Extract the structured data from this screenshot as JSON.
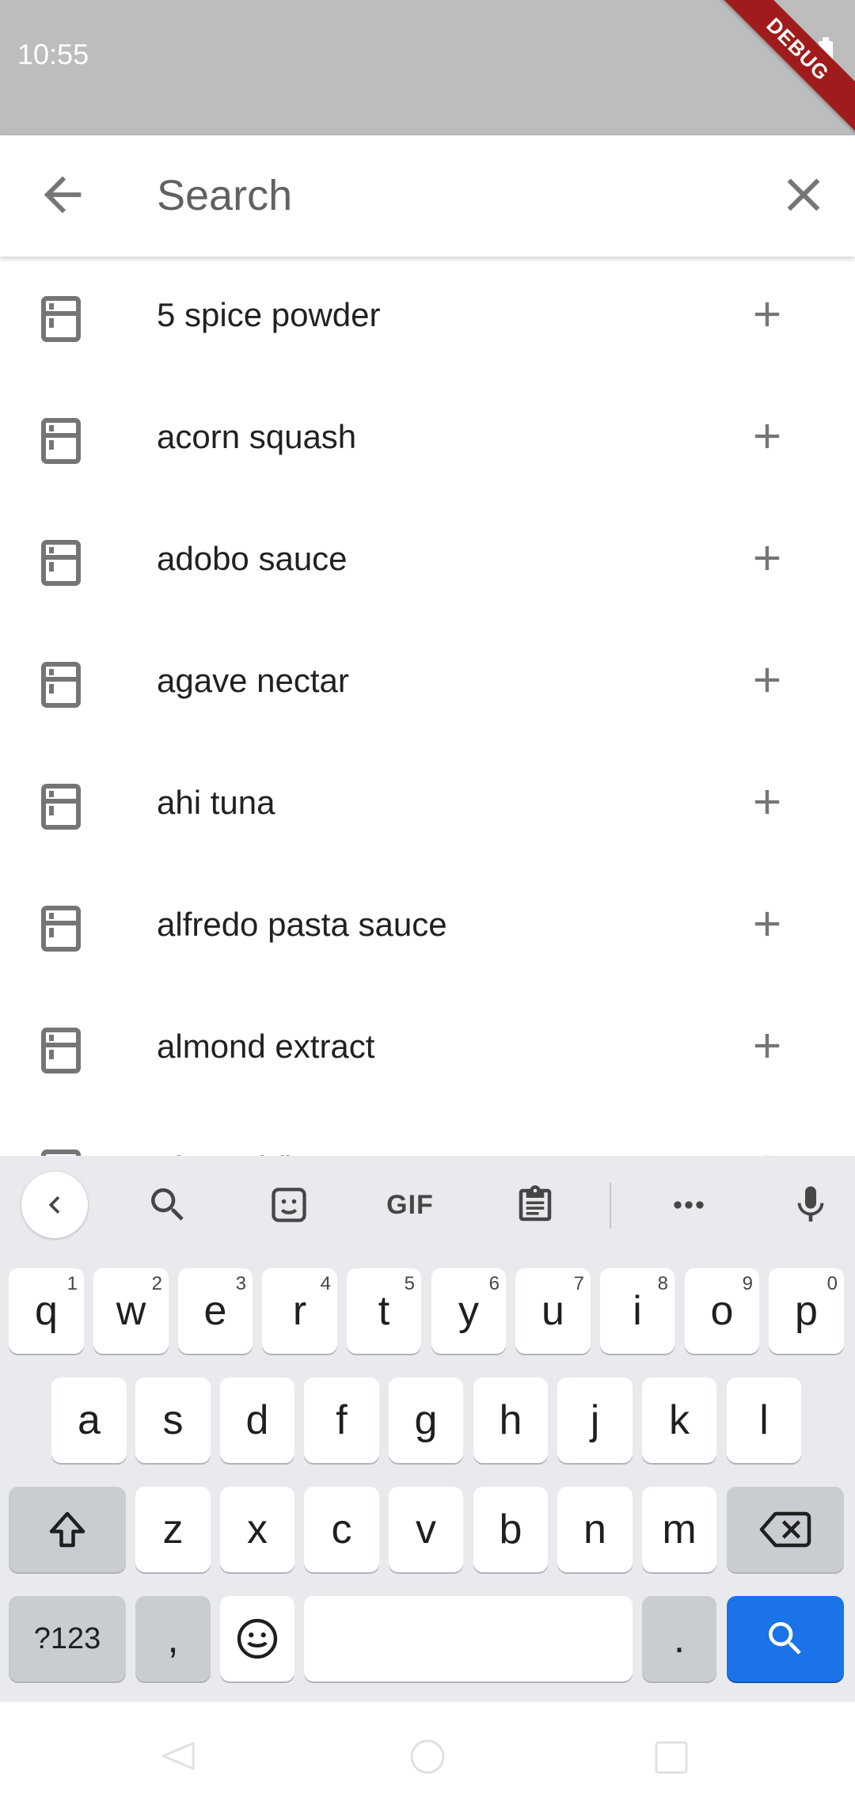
{
  "status_bar": {
    "time": "10:55",
    "debug_label": "DEBUG"
  },
  "search": {
    "placeholder": "Search",
    "value": ""
  },
  "items": [
    {
      "label": "5 spice powder"
    },
    {
      "label": "acorn squash"
    },
    {
      "label": "adobo sauce"
    },
    {
      "label": "agave nectar"
    },
    {
      "label": "ahi tuna"
    },
    {
      "label": "alfredo pasta sauce"
    },
    {
      "label": "almond extract"
    },
    {
      "label": "almond flour"
    }
  ],
  "keyboard": {
    "toolbar_gif": "GIF",
    "row1": [
      {
        "key": "q",
        "hint": "1"
      },
      {
        "key": "w",
        "hint": "2"
      },
      {
        "key": "e",
        "hint": "3"
      },
      {
        "key": "r",
        "hint": "4"
      },
      {
        "key": "t",
        "hint": "5"
      },
      {
        "key": "y",
        "hint": "6"
      },
      {
        "key": "u",
        "hint": "7"
      },
      {
        "key": "i",
        "hint": "8"
      },
      {
        "key": "o",
        "hint": "9"
      },
      {
        "key": "p",
        "hint": "0"
      }
    ],
    "row2": [
      "a",
      "s",
      "d",
      "f",
      "g",
      "h",
      "j",
      "k",
      "l"
    ],
    "row3": [
      "z",
      "x",
      "c",
      "v",
      "b",
      "n",
      "m"
    ],
    "symbols_label": "?123",
    "comma": ",",
    "period": ".",
    "accent_color": "#1a73e8"
  }
}
